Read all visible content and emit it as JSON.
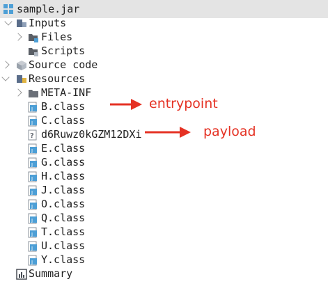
{
  "tree": {
    "root": "sample.jar",
    "inputs": "Inputs",
    "files": "Files",
    "scripts": "Scripts",
    "source_code": "Source code",
    "resources": "Resources",
    "meta_inf": "META-INF",
    "classes": [
      "B.class",
      "C.class",
      "d6Ruwz0kGZM12DXi",
      "E.class",
      "G.class",
      "H.class",
      "J.class",
      "O.class",
      "Q.class",
      "T.class",
      "U.class",
      "Y.class"
    ],
    "summary": "Summary"
  },
  "annotations": {
    "entrypoint": "entrypoint",
    "payload": "payload"
  },
  "colors": {
    "annotation": "#e53224",
    "titlebar": "#e4e4e4",
    "chevron": "#9a9a9a",
    "package_icon": "#4d9fd6"
  }
}
